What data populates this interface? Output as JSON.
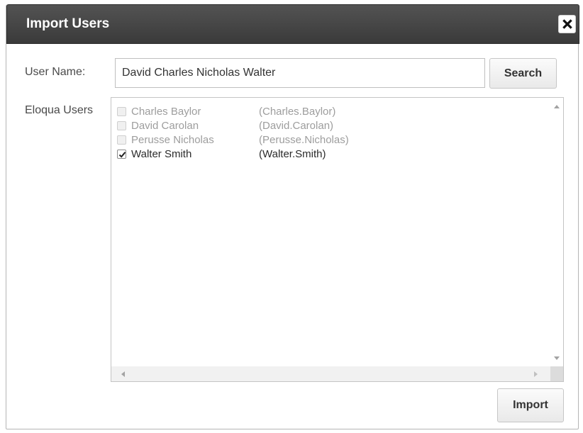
{
  "dialog": {
    "title": "Import Users",
    "close_icon": "close-icon"
  },
  "form": {
    "username_label": "User Name:",
    "username_value": "David Charles Nicholas Walter",
    "search_label": "Search",
    "users_label": "Eloqua Users",
    "import_label": "Import"
  },
  "users": [
    {
      "name": "Charles Baylor",
      "login": "(Charles.Baylor)",
      "checked": false,
      "enabled": false
    },
    {
      "name": "David Carolan",
      "login": "(David.Carolan)",
      "checked": false,
      "enabled": false
    },
    {
      "name": "Perusse Nicholas",
      "login": "(Perusse.Nicholas)",
      "checked": false,
      "enabled": false
    },
    {
      "name": "Walter Smith",
      "login": "(Walter.Smith)",
      "checked": true,
      "enabled": true
    }
  ],
  "colors": {
    "titlebar": "#444444",
    "disabled_text": "#9d9d9d",
    "enabled_text": "#2b2b2b"
  }
}
